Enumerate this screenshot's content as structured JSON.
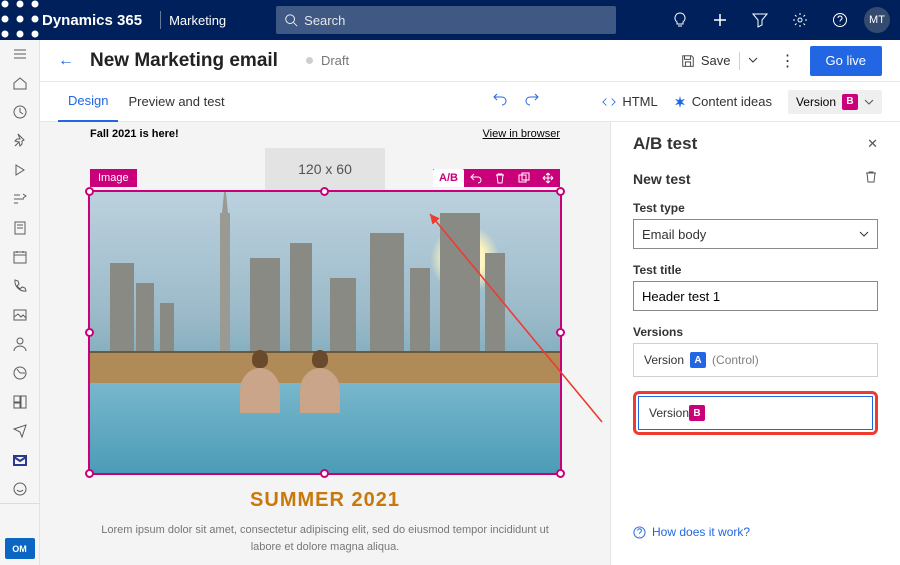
{
  "topbar": {
    "brand": "Dynamics 365",
    "module": "Marketing",
    "search_placeholder": "Search",
    "avatar": "MT"
  },
  "page": {
    "title": "New Marketing email",
    "status": "Draft",
    "save": "Save",
    "golive": "Go live"
  },
  "tabs": {
    "design": "Design",
    "preview": "Preview and test",
    "html": "HTML",
    "ideas": "Content ideas",
    "version_label": "Version",
    "version_letter": "B"
  },
  "email": {
    "headline": "Fall 2021 is here!",
    "view_in_browser": "View in browser",
    "logo_placeholder": "120 x 60",
    "selection_tag": "Image",
    "ab_tab": "A/B",
    "summer_heading": "SUMMER 2021",
    "lorem": "Lorem ipsum dolor sit amet, consectetur adipiscing elit, sed do eiusmod tempor incididunt ut labore et dolore magna aliqua."
  },
  "panel": {
    "title": "A/B test",
    "new_test": "New test",
    "type_label": "Test type",
    "type_value": "Email body",
    "title_label": "Test title",
    "title_value": "Header test 1",
    "versions_label": "Versions",
    "version_word": "Version",
    "letter_a": "A",
    "letter_b": "B",
    "control": "(Control)",
    "how": "How does it work?"
  },
  "area": "OM"
}
